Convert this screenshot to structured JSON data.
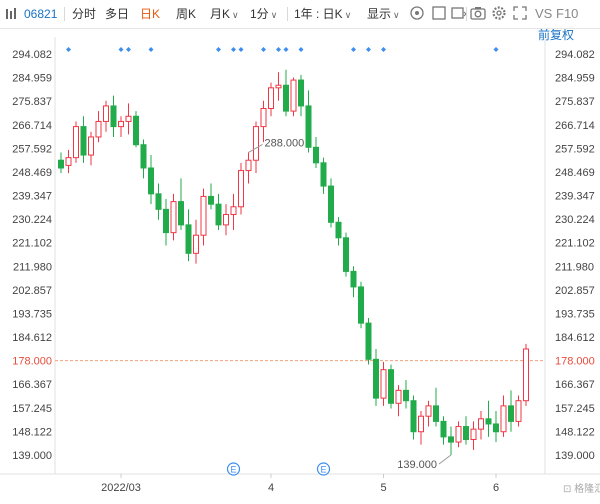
{
  "toolbar": {
    "code": "06821",
    "items": [
      {
        "label": "分时",
        "active": false
      },
      {
        "label": "多日",
        "active": false
      },
      {
        "label": "日K",
        "active": true
      },
      {
        "label": "周K",
        "active": false
      },
      {
        "label": "月K",
        "active": false
      },
      {
        "label": "1分",
        "active": false
      },
      {
        "label": "1年 : 日K",
        "active": false
      },
      {
        "label": "显示",
        "active": false
      }
    ],
    "vs_label": "VS",
    "f10_label": "F10",
    "adjust_label": "前复权",
    "icons": [
      "search-icon",
      "checkbox-icon",
      "rectangle-icon",
      "camera-icon",
      "gear-icon",
      "expand-icon"
    ]
  },
  "colors": {
    "up": "#f23645",
    "down": "#22ab4a",
    "price_line": "#f0a07a",
    "price_tag": "#e74c3c",
    "marker": "#3d8ef0",
    "grid": "#eeeeee"
  },
  "chart_data": {
    "type": "candlestick",
    "ylim": [
      139.0,
      294.082
    ],
    "yticks": [
      "294.082",
      "284.959",
      "275.837",
      "266.714",
      "257.592",
      "248.469",
      "239.347",
      "230.224",
      "221.102",
      "211.980",
      "202.857",
      "193.735",
      "184.612",
      "178.000",
      "166.367",
      "157.245",
      "148.122",
      "139.000"
    ],
    "xticks": [
      "2022/03",
      "4",
      "5",
      "6"
    ],
    "xtick_index": [
      8,
      28,
      43,
      58
    ],
    "current_price": "178.000",
    "annotations": [
      {
        "label": "288.000",
        "index": 25
      },
      {
        "label": "139.000",
        "index": 52
      }
    ],
    "event_markers": [
      {
        "label": "E",
        "index": 23
      },
      {
        "label": "E",
        "index": 35
      }
    ],
    "dividend_dots": [
      1,
      8,
      9,
      12,
      21,
      23,
      24,
      27,
      29,
      30,
      32,
      39,
      41,
      43,
      58
    ],
    "ohlc": [
      [
        253,
        256,
        248,
        250
      ],
      [
        251,
        257,
        248,
        254
      ],
      [
        254,
        268,
        252,
        266
      ],
      [
        266,
        270,
        252,
        255
      ],
      [
        255,
        264,
        251,
        262
      ],
      [
        262,
        272,
        260,
        268
      ],
      [
        268,
        276,
        264,
        274
      ],
      [
        274,
        278,
        262,
        266
      ],
      [
        266,
        270,
        262,
        268
      ],
      [
        268,
        275,
        263,
        270
      ],
      [
        270,
        272,
        258,
        259
      ],
      [
        259,
        261,
        246,
        250
      ],
      [
        250,
        255,
        236,
        240
      ],
      [
        240,
        244,
        230,
        234
      ],
      [
        234,
        238,
        220,
        225
      ],
      [
        225,
        240,
        222,
        237
      ],
      [
        237,
        246,
        226,
        228
      ],
      [
        228,
        234,
        214,
        217
      ],
      [
        217,
        230,
        213,
        224
      ],
      [
        224,
        242,
        220,
        239
      ],
      [
        239,
        244,
        234,
        236
      ],
      [
        236,
        240,
        226,
        228
      ],
      [
        228,
        236,
        224,
        232
      ],
      [
        232,
        240,
        226,
        235
      ],
      [
        235,
        252,
        232,
        249
      ],
      [
        249,
        256,
        244,
        253
      ],
      [
        253,
        268,
        248,
        266
      ],
      [
        266,
        276,
        260,
        273
      ],
      [
        273,
        283,
        270,
        281
      ],
      [
        281,
        287,
        276,
        282
      ],
      [
        282,
        288,
        270,
        272
      ],
      [
        272,
        285,
        270,
        284
      ],
      [
        284,
        286,
        270,
        274
      ],
      [
        274,
        280,
        256,
        258
      ],
      [
        258,
        262,
        250,
        252
      ],
      [
        252,
        254,
        240,
        243
      ],
      [
        243,
        246,
        227,
        229
      ],
      [
        229,
        231,
        220,
        223
      ],
      [
        223,
        225,
        208,
        210
      ],
      [
        210,
        212,
        200,
        204
      ],
      [
        204,
        206,
        188,
        190
      ],
      [
        190,
        192,
        174,
        176
      ],
      [
        176,
        180,
        158,
        161
      ],
      [
        161,
        175,
        158,
        172
      ],
      [
        172,
        174,
        157,
        159
      ],
      [
        159,
        166,
        154,
        164
      ],
      [
        164,
        168,
        157,
        160
      ],
      [
        160,
        162,
        145,
        148
      ],
      [
        148,
        156,
        143,
        154
      ],
      [
        154,
        160,
        150,
        158
      ],
      [
        158,
        165,
        150,
        152
      ],
      [
        152,
        154,
        143,
        146
      ],
      [
        146,
        150,
        139,
        144
      ],
      [
        144,
        152,
        142,
        150
      ],
      [
        150,
        154,
        143,
        145
      ],
      [
        145,
        152,
        141,
        149
      ],
      [
        149,
        156,
        145,
        153
      ],
      [
        153,
        160,
        146,
        151
      ],
      [
        151,
        156,
        144,
        148
      ],
      [
        148,
        162,
        146,
        158
      ],
      [
        158,
        164,
        148,
        152
      ],
      [
        152,
        162,
        150,
        160
      ],
      [
        160,
        182,
        158,
        180
      ]
    ]
  },
  "watermark": "格隆汇"
}
